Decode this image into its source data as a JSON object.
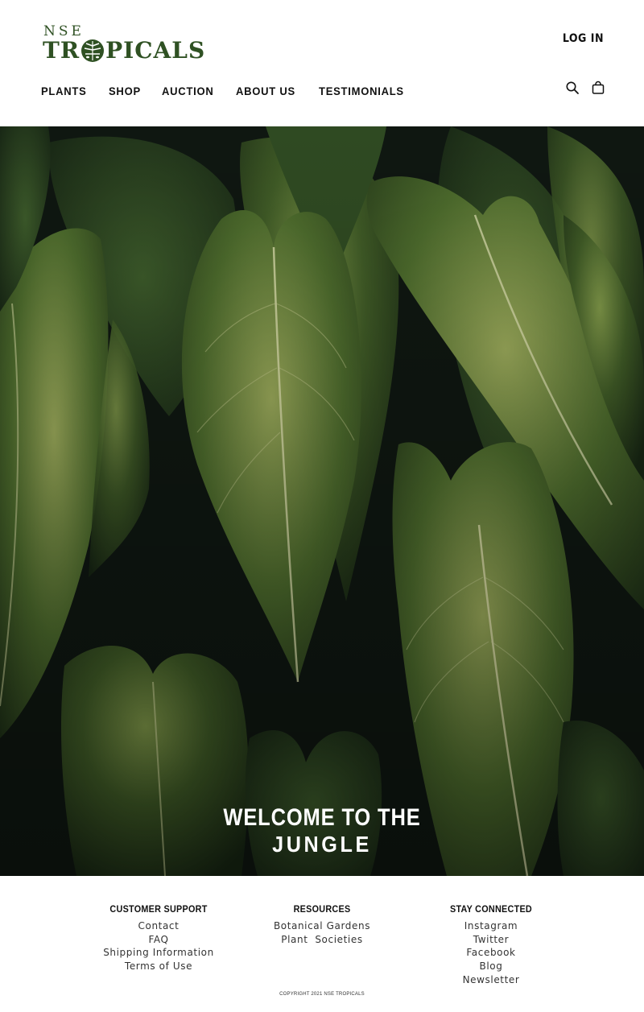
{
  "brand": {
    "logo_top": "NSE",
    "logo_main_left": "TR",
    "logo_main_right": "PICALS",
    "color": "#2f5123"
  },
  "header": {
    "login_label": "LOG IN",
    "nav": [
      "PLANTS",
      "SHOP",
      "AUCTION",
      "ABOUT US",
      "TESTIMONIALS"
    ],
    "icons": [
      "search-icon",
      "cart-bag-icon"
    ]
  },
  "hero": {
    "line1": "WELCOME TO THE",
    "line2": "JUNGLE",
    "image": "tropical-leaves-photo"
  },
  "footer": {
    "customer_support": {
      "title": "CUSTOMER SUPPORT",
      "links": [
        "Contact",
        "FAQ",
        "Shipping Information",
        "Terms of Use"
      ]
    },
    "resources": {
      "title": "RESOURCES",
      "links": [
        "Botanical Gardens",
        "Plant  Societies"
      ]
    },
    "stay_connected": {
      "title": "STAY CONNECTED",
      "links": [
        "Instagram",
        "Twitter",
        "Facebook",
        "Blog",
        "Newsletter"
      ]
    },
    "copyright": "COPYRIGHT 2021 NSE TROPICALS"
  }
}
